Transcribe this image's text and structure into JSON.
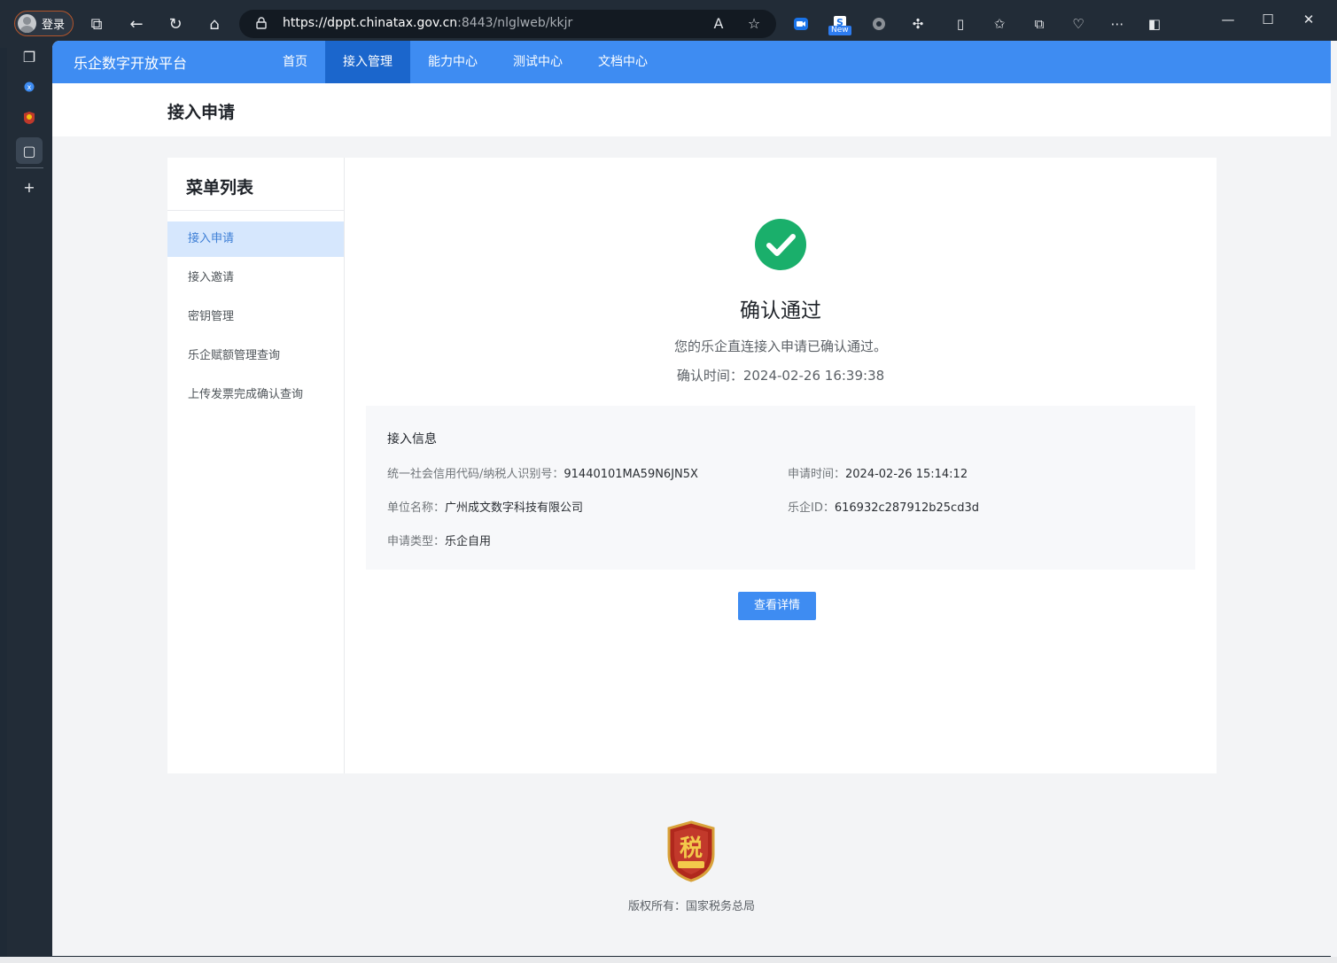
{
  "browser": {
    "profile_label": "登录",
    "url_host": "https://dppt.chinatax.gov.cn",
    "url_path": ":8443/nlglweb/kkjr",
    "new_badge": "New"
  },
  "nav": {
    "brand": "乐企数字开放平台",
    "items": [
      {
        "label": "首页"
      },
      {
        "label": "接入管理"
      },
      {
        "label": "能力中心"
      },
      {
        "label": "测试中心"
      },
      {
        "label": "文档中心"
      }
    ]
  },
  "page_title": "接入申请",
  "menu": {
    "title": "菜单列表",
    "items": [
      {
        "label": "接入申请"
      },
      {
        "label": "接入邀请"
      },
      {
        "label": "密钥管理"
      },
      {
        "label": "乐企赋额管理查询"
      },
      {
        "label": "上传发票完成确认查询"
      }
    ]
  },
  "result": {
    "title": "确认通过",
    "description": "您的乐企直连接入申请已确认通过。",
    "time": "确认时间：2024-02-26 16:39:38"
  },
  "info": {
    "heading": "接入信息",
    "credit_code_label": "统一社会信用代码/纳税人识别号：",
    "credit_code_value": "91440101MA59N6JN5X",
    "apply_time_label": "申请时间：",
    "apply_time_value": "2024-02-26 15:14:12",
    "unit_name_label": "单位名称：",
    "unit_name_value": "广州成文数字科技有限公司",
    "leqi_id_label": "乐企ID：",
    "leqi_id_value": "616932c287912b25cd3d",
    "apply_type_label": "申请类型：",
    "apply_type_value": "乐企自用"
  },
  "detail_button": "查看详情",
  "footer": {
    "emblem_text": "税",
    "copyright": "版权所有：国家税务总局"
  },
  "colors": {
    "primary": "#3e8cf2",
    "nav_active": "#1b66cc",
    "success": "#1aaf6b"
  }
}
